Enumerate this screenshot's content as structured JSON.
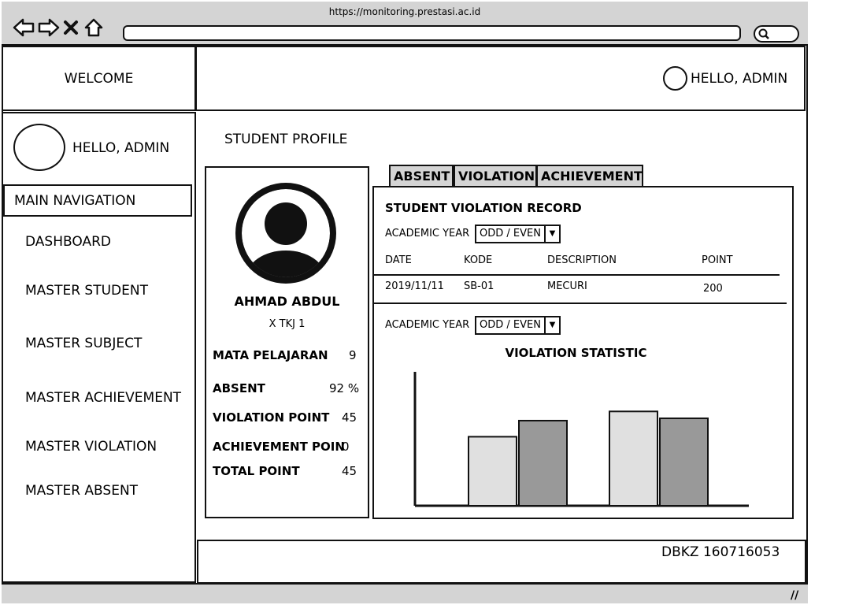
{
  "browser": {
    "url": "https://monitoring.prestasi.ac.id",
    "icons": [
      "back-arrow-icon",
      "forward-arrow-icon",
      "close-icon",
      "home-icon",
      "search-icon",
      "resize-grip-icon"
    ]
  },
  "header": {
    "welcome": "WELCOME",
    "greeting": "HELLO, ADMIN"
  },
  "sidebar": {
    "greeting": "HELLO, ADMIN",
    "section_label": "MAIN NAVIGATION",
    "items": [
      {
        "label": "DASHBOARD"
      },
      {
        "label": "MASTER  STUDENT"
      },
      {
        "label": "MASTER SUBJECT"
      },
      {
        "label": "MASTER ACHIEVEMENT"
      },
      {
        "label": "MASTER VIOLATION"
      },
      {
        "label": "MASTER ABSENT"
      }
    ]
  },
  "content": {
    "title": "STUDENT PROFILE"
  },
  "profile": {
    "name": "AHMAD ABDUL",
    "class": "X TKJ 1",
    "stats": [
      {
        "label": "MATA PELAJARAN",
        "value": "9"
      },
      {
        "label": "ABSENT",
        "value": "92 %"
      },
      {
        "label": "VIOLATION POINT",
        "value": "45"
      },
      {
        "label": "ACHIEVEMENT POIN",
        "value": "0"
      },
      {
        "label": "TOTAL POINT",
        "value": "45"
      }
    ]
  },
  "tabs": [
    {
      "label": "ABSENT"
    },
    {
      "label": "VIOLATION"
    },
    {
      "label": "ACHIEVEMENT"
    }
  ],
  "violation_panel": {
    "title": "STUDENT VIOLATION RECORD",
    "academic_year_label": "ACADEMIC YEAR",
    "academic_year_value": "ODD / EVEN",
    "columns": [
      "DATE",
      "KODE",
      "DESCRIPTION",
      "POINT"
    ],
    "rows": [
      [
        "2019/11/11",
        "SB-01",
        "MECURI",
        "200"
      ]
    ],
    "academic_year_label_2": "ACADEMIC YEAR",
    "academic_year_value_2": "ODD / EVEN",
    "chart_title": "VIOLATION STATISTIC"
  },
  "chart_data": {
    "type": "bar",
    "title": "VIOLATION STATISTIC",
    "categories": [
      "",
      ""
    ],
    "series": [
      {
        "values": [
          3,
          4.1
        ],
        "color": "#e0e0e0"
      },
      {
        "values": [
          3.7,
          3.8
        ],
        "color": "#999999"
      }
    ],
    "ylim": [
      0,
      5
    ],
    "grid": false
  },
  "footer": {
    "text": "DBKZ 160716053"
  },
  "colors": {
    "chrome_gray": "#d4d4d4",
    "border": "#111111",
    "bar_light": "#e0e0e0",
    "bar_dark": "#999999"
  }
}
